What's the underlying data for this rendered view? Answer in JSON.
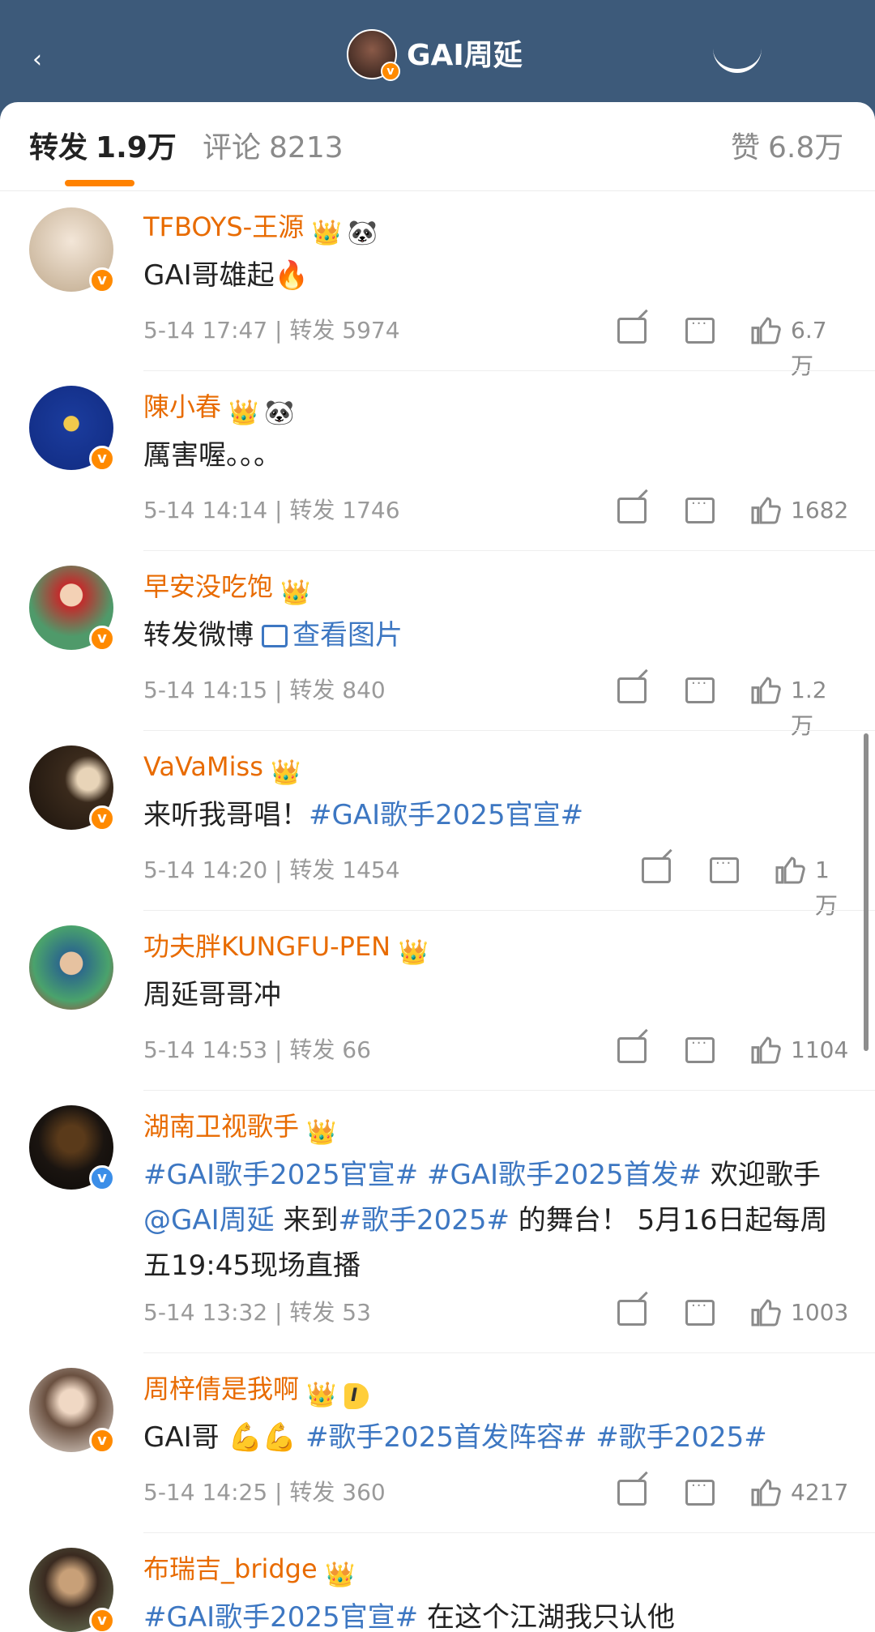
{
  "header": {
    "title": "GAI周延",
    "verified_badge": "v",
    "back_icon": "chevron-left-icon",
    "share_icon": "share-icon"
  },
  "tabs": {
    "repost_label": "转发",
    "repost_count": "1.9万",
    "comment_label": "评论",
    "comment_count": "8213",
    "like_label": "赞",
    "like_count": "6.8万"
  },
  "colors": {
    "header_bg": "#3d5a7a",
    "accent": "#ff8200",
    "name": "#e86b00",
    "topic_link": "#3d77c2"
  },
  "reposts": [
    {
      "name": "TFBOYS-王源",
      "badges": [
        "crown-icon",
        "panda-icon"
      ],
      "text": "GAI哥雄起",
      "emoji": "🔥",
      "verify": "orange",
      "time": "5-14 17:47",
      "repost_label": "转发",
      "repost_count": "5974",
      "likes": "6.7万"
    },
    {
      "name": "陳小春",
      "badges": [
        "crown-icon",
        "panda-icon"
      ],
      "text": "厲害喔。。。",
      "verify": "orange",
      "time": "5-14 14:14",
      "repost_label": "转发",
      "repost_count": "1746",
      "likes": "1682"
    },
    {
      "name": "早安没吃饱",
      "badges": [
        "crown-icon"
      ],
      "text": "转发微博",
      "link": "查看图片",
      "verify": "orange",
      "time": "5-14 14:15",
      "repost_label": "转发",
      "repost_count": "840",
      "likes": "1.2万"
    },
    {
      "name": "VaVaMiss",
      "badges": [
        "crown-icon"
      ],
      "text": "来听我哥唱！",
      "tag": "#GAI歌手2025官宣#",
      "verify": "orange",
      "time": "5-14 14:20",
      "repost_label": "转发",
      "repost_count": "1454",
      "likes": "1万"
    },
    {
      "name": "功夫胖KUNGFU-PEN",
      "badges": [
        "crown-icon"
      ],
      "text": "周延哥哥冲",
      "verify": "none",
      "time": "5-14 14:53",
      "repost_label": "转发",
      "repost_count": "66",
      "likes": "1104"
    },
    {
      "name": "湖南卫视歌手",
      "badges": [
        "crown-icon"
      ],
      "tag1": "#GAI歌手2025官宣#",
      "tag2": "#GAI歌手2025首发#",
      "text1": " 欢迎歌手 ",
      "mention": "@GAI周延",
      "text2": " 来到",
      "tag3": "#歌手2025#",
      "text3": " 的舞台！ 5月16日起每周五19:45现场直播",
      "verify": "blue",
      "time": "5-14 13:32",
      "repost_label": "转发",
      "repost_count": "53",
      "likes": "1003"
    },
    {
      "name": "周梓倩是我啊",
      "badges": [
        "crown-icon",
        "level-badge"
      ],
      "level": "I",
      "text": "GAI哥",
      "emoji": "💪💪",
      "tag1": "#歌手2025首发阵容#",
      "tag2": "#歌手2025#",
      "verify": "orange",
      "time": "5-14 14:25",
      "repost_label": "转发",
      "repost_count": "360",
      "likes": "4217"
    },
    {
      "name": "布瑞吉_bridge",
      "badges": [
        "crown-icon"
      ],
      "tag": "#GAI歌手2025官宣#",
      "text": " 在这个江湖我只认他",
      "verify": "orange"
    }
  ]
}
